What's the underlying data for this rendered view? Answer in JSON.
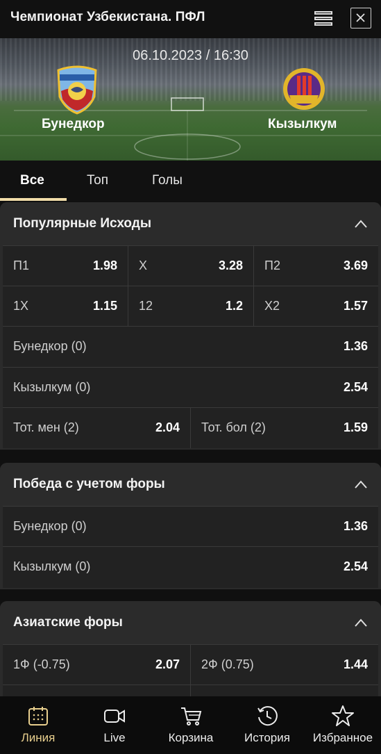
{
  "header": {
    "title": "Чемпионат Узбекистана. ПФЛ"
  },
  "match": {
    "datetime": "06.10.2023 / 16:30",
    "home": "Бунедкор",
    "away": "Кызылкум",
    "home_logo_text": "BUNYODKOR"
  },
  "tabs": [
    {
      "label": "Все",
      "active": true
    },
    {
      "label": "Топ",
      "active": false
    },
    {
      "label": "Голы",
      "active": false
    }
  ],
  "sections": [
    {
      "title": "Популярные Исходы",
      "rows": [
        [
          {
            "label": "П1",
            "odd": "1.98"
          },
          {
            "label": "X",
            "odd": "3.28"
          },
          {
            "label": "П2",
            "odd": "3.69"
          }
        ],
        [
          {
            "label": "1X",
            "odd": "1.15"
          },
          {
            "label": "12",
            "odd": "1.2"
          },
          {
            "label": "X2",
            "odd": "1.57"
          }
        ],
        [
          {
            "label": "Бунедкор (0)",
            "odd": "1.36"
          }
        ],
        [
          {
            "label": "Кызылкум (0)",
            "odd": "2.54"
          }
        ],
        [
          {
            "label": "Тот. мен (2)",
            "odd": "2.04"
          },
          {
            "label": "Тот. бол (2)",
            "odd": "1.59"
          }
        ]
      ]
    },
    {
      "title": "Победа с учетом форы",
      "rows": [
        [
          {
            "label": "Бунедкор (0)",
            "odd": "1.36"
          }
        ],
        [
          {
            "label": "Кызылкум (0)",
            "odd": "2.54"
          }
        ]
      ]
    },
    {
      "title": "Азиатские форы",
      "rows": [
        [
          {
            "label": "1Ф (-0.75)",
            "odd": "2.07"
          },
          {
            "label": "2Ф (0.75)",
            "odd": "1.44"
          }
        ]
      ]
    }
  ],
  "bottom_nav": [
    {
      "label": "Линия",
      "icon": "calendar-icon",
      "active": true
    },
    {
      "label": "Live",
      "icon": "video-camera-icon",
      "active": false
    },
    {
      "label": "Корзина",
      "icon": "cart-icon",
      "active": false
    },
    {
      "label": "История",
      "icon": "history-clock-icon",
      "active": false
    },
    {
      "label": "Избранное",
      "icon": "star-icon",
      "active": false
    }
  ],
  "colors": {
    "accent": "#e8cf8e",
    "card": "#2b2b2b",
    "row": "#222222",
    "background": "#101010"
  }
}
